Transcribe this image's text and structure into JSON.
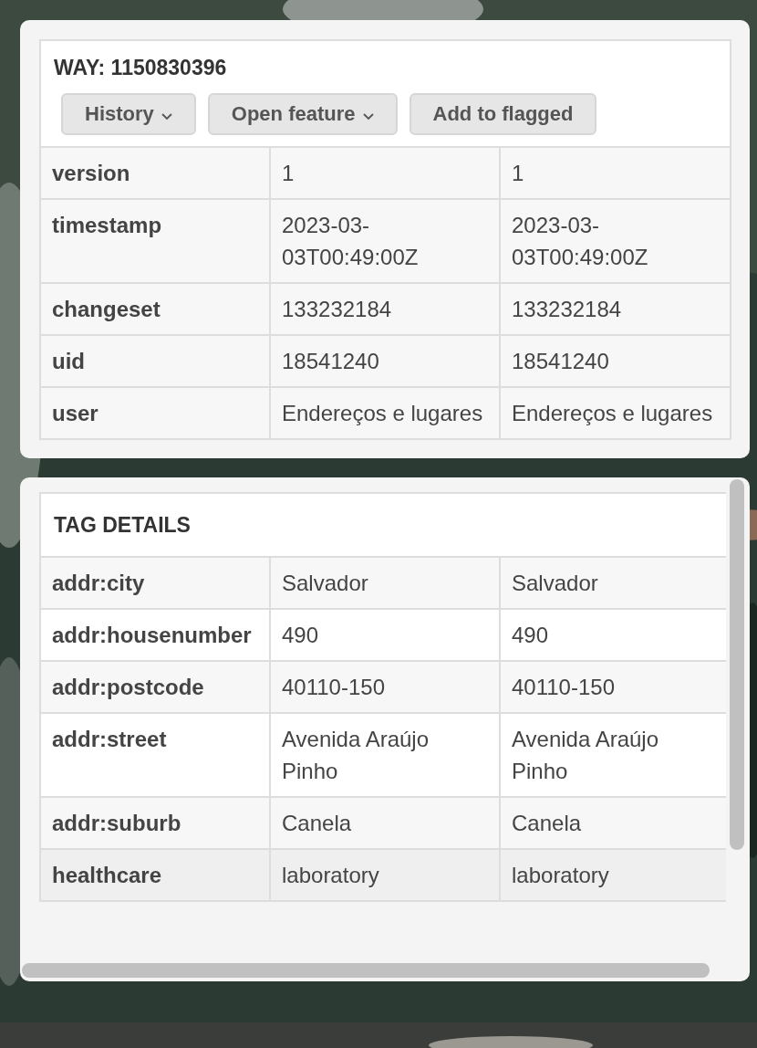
{
  "feature": {
    "title": "WAY: 1150830396",
    "buttons": [
      {
        "label": "History",
        "dropdown": true
      },
      {
        "label": "Open feature",
        "dropdown": true
      },
      {
        "label": "Add to flagged",
        "dropdown": false
      }
    ],
    "rows": [
      {
        "key": "version",
        "values": [
          "1",
          "1"
        ]
      },
      {
        "key": "timestamp",
        "values": [
          "2023-03-03T00:49:00Z",
          "2023-03-03T00:49:00Z"
        ]
      },
      {
        "key": "changeset",
        "values": [
          "133232184",
          "133232184"
        ]
      },
      {
        "key": "uid",
        "values": [
          "18541240",
          "18541240"
        ]
      },
      {
        "key": "user",
        "values": [
          "Endereços e lugares",
          "Endereços e lugares"
        ]
      }
    ]
  },
  "tag_details": {
    "title": "TAG DETAILS",
    "rows": [
      {
        "key": "addr:city",
        "values": [
          "Salvador",
          "Salvador"
        ]
      },
      {
        "key": "addr:housenumber",
        "values": [
          "490",
          "490"
        ]
      },
      {
        "key": "addr:postcode",
        "values": [
          "40110-150",
          "40110-150"
        ]
      },
      {
        "key": "addr:street",
        "values": [
          "Avenida Araújo Pinho",
          "Avenida Araújo Pinho"
        ]
      },
      {
        "key": "addr:suburb",
        "values": [
          "Canela",
          "Canela"
        ]
      },
      {
        "key": "healthcare",
        "values": [
          "laboratory",
          "laboratory"
        ]
      }
    ]
  }
}
